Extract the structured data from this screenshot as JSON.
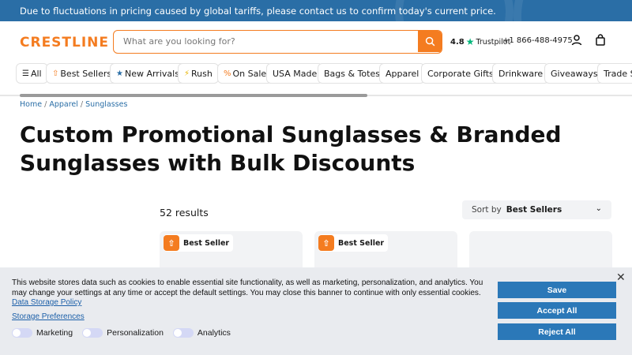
{
  "topbar": {
    "message": "Due to fluctuations in pricing caused by global tariffs, please contact us to confirm today's current price."
  },
  "header": {
    "logo": "CRESTLINE",
    "search_placeholder": "What are you looking for?",
    "rating": "4.8",
    "rating_source": "Trustpilot",
    "phone": "+1 866-488-4975"
  },
  "nav": {
    "items": [
      {
        "label": "All",
        "icon": "menu-icon"
      },
      {
        "label": "Best Sellers",
        "icon": "badge-icon"
      },
      {
        "label": "New Arrivals",
        "icon": "star-icon"
      },
      {
        "label": "Rush",
        "icon": "lightning-icon"
      },
      {
        "label": "On Sale",
        "icon": "percent-icon"
      },
      {
        "label": "USA Made"
      },
      {
        "label": "Bags & Totes"
      },
      {
        "label": "Apparel"
      },
      {
        "label": "Corporate Gifts"
      },
      {
        "label": "Drinkware"
      },
      {
        "label": "Giveaways"
      },
      {
        "label": "Trade Sh"
      }
    ]
  },
  "breadcrumb": [
    "Home",
    "Apparel",
    "Sunglasses"
  ],
  "page_title": "Custom Promotional Sunglasses & Branded Sunglasses with Bulk Discounts",
  "results": "52 results",
  "sort": {
    "label": "Sort by",
    "value": "Best Sellers"
  },
  "cards": [
    {
      "badge": "Best Seller"
    },
    {
      "badge": "Best Seller"
    },
    {
      "badge": ""
    }
  ],
  "cookie": {
    "text": "This website stores data such as cookies to enable essential site functionality, as well as marketing, personalization, and analytics. You may change your settings at any time or accept the default settings. You may close this banner to continue with only essential cookies.",
    "policy_link": "Data Storage Policy",
    "prefs_link": "Storage Preferences",
    "toggles": [
      "Marketing",
      "Personalization",
      "Analytics"
    ],
    "save": "Save",
    "accept": "Accept All",
    "reject": "Reject All"
  },
  "colors": {
    "brand": "#f47c20",
    "topbar": "#2a6ea6",
    "button": "#2b78b8"
  }
}
